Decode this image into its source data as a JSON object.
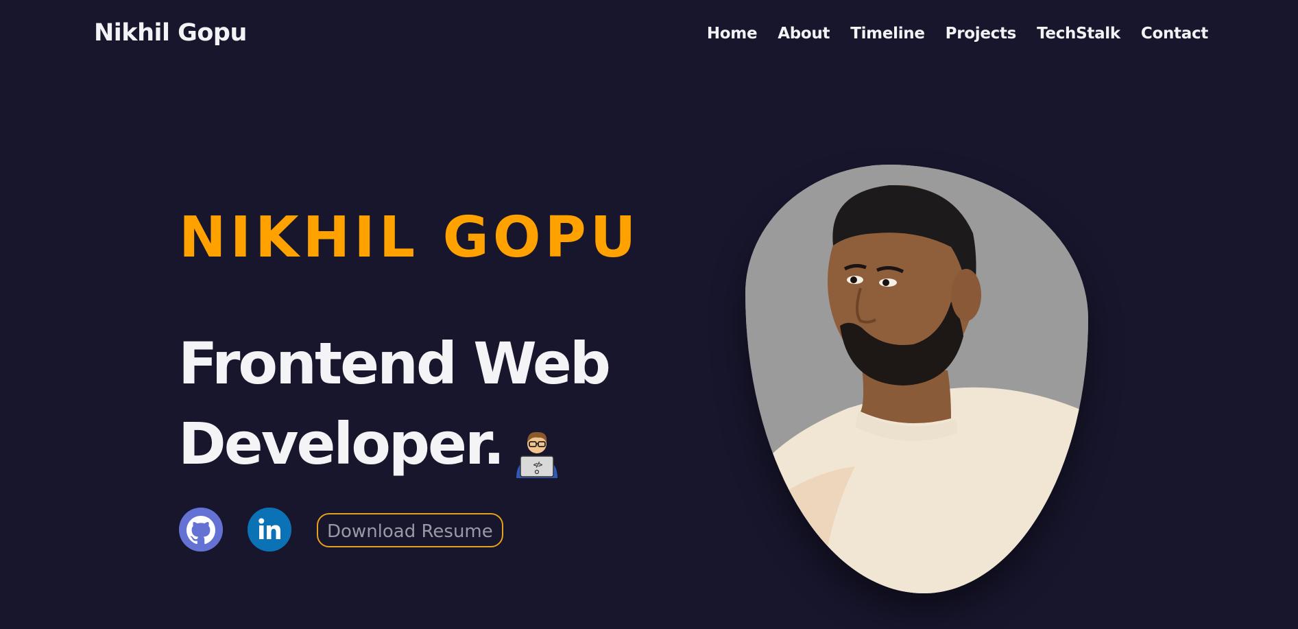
{
  "header": {
    "brand": "Nikhil Gopu",
    "nav": [
      "Home",
      "About",
      "Timeline",
      "Projects",
      "TechStalk",
      "Contact"
    ]
  },
  "hero": {
    "name": "NIKHIL GOPU",
    "title_line1": "Frontend Web",
    "title_line2": "Developer.",
    "title_icon": "technologist-emoji-icon"
  },
  "socials": [
    {
      "icon": "github-icon",
      "color": "#6473d3"
    },
    {
      "icon": "linkedin-icon",
      "color": "#0a72b5"
    }
  ],
  "resume_button": "Download Resume",
  "colors": {
    "background": "#18162d",
    "accent": "#ffa200",
    "text": "#f4f4f7",
    "button_border": "#e9a01d",
    "button_text": "#9a99a6"
  },
  "portrait": {
    "alt_icon": "profile-photo",
    "background": "#9b9b9b"
  }
}
